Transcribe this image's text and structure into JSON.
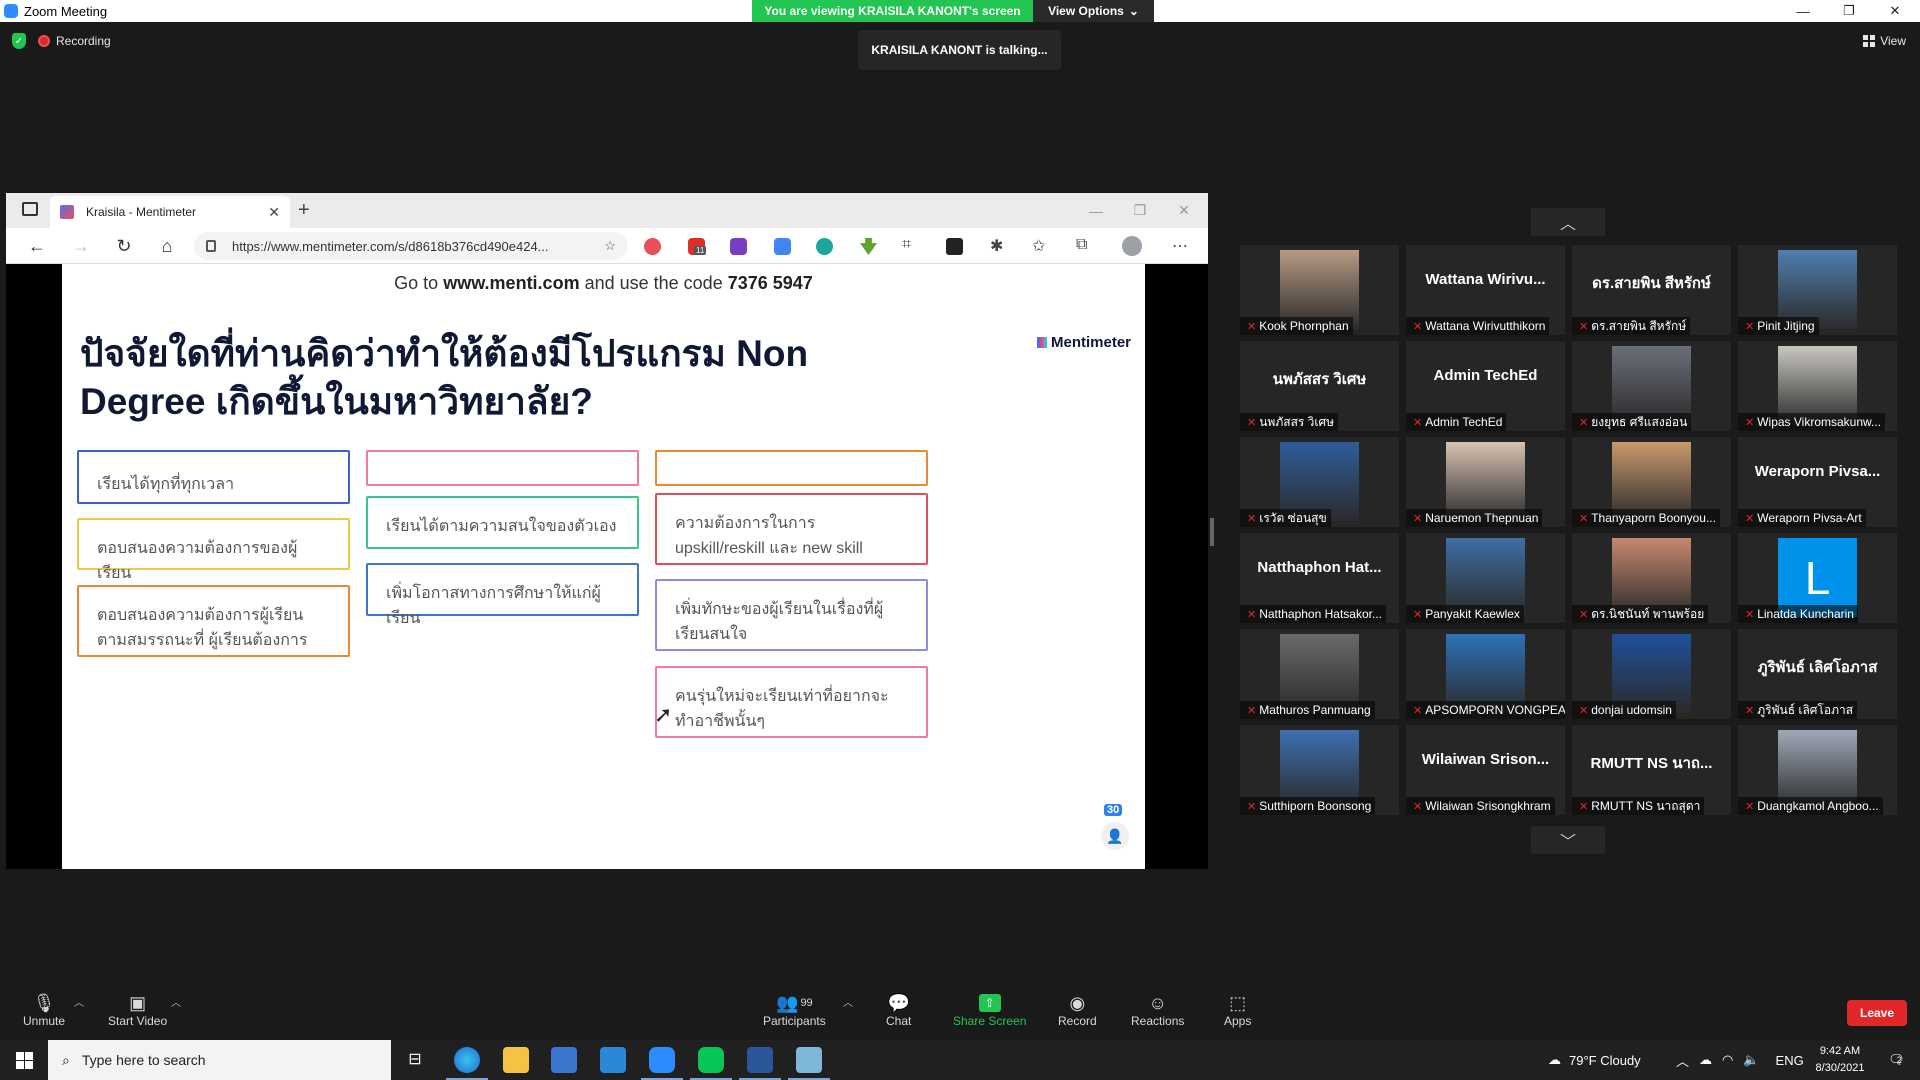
{
  "window": {
    "title": "Zoom Meeting",
    "viewing_banner": "You are viewing KRAISILA KANONT's screen",
    "view_options": "View Options"
  },
  "top": {
    "recording": "Recording",
    "talking": "KRAISILA KANONT is talking...",
    "view": "View"
  },
  "browser": {
    "tab_title": "Kraisila - Mentimeter",
    "url": "https://www.mentimeter.com/s/d8618b376cd490e424...",
    "ext_badge": "11"
  },
  "slide": {
    "code_prefix": "Go to",
    "code_site": "www.menti.com",
    "code_mid": "and use the code",
    "code_value": "7376 5947",
    "question": "ปัจจัยใดที่ท่านคิดว่าทำให้ต้องมีโปรแกรม Non Degree เกิดขึ้นในมหาวิทยาลัย?",
    "brand": "Mentimeter",
    "participants": "30",
    "cards": [
      {
        "text": "เรียนได้ทุกที่ทุกเวลา",
        "color": "#3a62c9"
      },
      {
        "text": "ตอบสนองความต้องการของผู้เรียน",
        "color": "#f2c84b"
      },
      {
        "text": "ตอบสนองความต้องการผู้เรียน ตามสมรรถนะที่ ผู้เรียนต้องการ",
        "color": "#e8893a"
      },
      {
        "text": "",
        "color": "#ef7aa0"
      },
      {
        "text": "เรียนได้ตามความสนใจของตัวเอง",
        "color": "#3ec48b"
      },
      {
        "text": "เพิ่มโอกาสทางการศึกษาให้แก่ผู้เรียน",
        "color": "#3b78c9"
      },
      {
        "text": "",
        "color": "#e8893a"
      },
      {
        "text": "ความต้องการในการ upskill/reskill และ new skill",
        "color": "#e0505b"
      },
      {
        "text": "เพิ่มทักษะของผู้เรียนในเรื่องที่ผู้เรียนสนใจ",
        "color": "#8d8ce0"
      },
      {
        "text": "คนรุ่นใหม่จะเรียนเท่าที่อยากจะทำอาชีพนั้นๆ",
        "color": "#ef7aa0"
      }
    ]
  },
  "gallery": {
    "tiles": [
      {
        "label": "Kook Phornphan",
        "kind": "photo",
        "bg": "#b79a84"
      },
      {
        "label": "Wattana Wirivutthikorn",
        "kind": "name",
        "name": "Wattana  Wirivu..."
      },
      {
        "label": "ดร.สายพิน  สีหรักษ์",
        "kind": "name",
        "name": "ดร.สายพิน สีหรักษ์"
      },
      {
        "label": "Pinit Jitjing",
        "kind": "photo",
        "bg": "#4f7fb0"
      },
      {
        "label": "นพภัสสร วิเศษ",
        "kind": "name",
        "name": "นพภัสสร วิเศษ"
      },
      {
        "label": "Admin TechEd",
        "kind": "name",
        "name": "Admin TechEd"
      },
      {
        "label": "ยงยุทธ ศรีแสงอ่อน",
        "kind": "photo",
        "bg": "#6b6f7a"
      },
      {
        "label": "Wipas Vikromsakunw...",
        "kind": "photo",
        "bg": "#c9c6c0"
      },
      {
        "label": "เรวัต ซ่อนสุข",
        "kind": "photo",
        "bg": "#2f5d9a"
      },
      {
        "label": "Naruemon Thepnuan",
        "kind": "photo",
        "bg": "#d8c2b2"
      },
      {
        "label": "Thanyaporn Boonyou...",
        "kind": "photo",
        "bg": "#c99a6a"
      },
      {
        "label": "Weraporn Pivsa-Art",
        "kind": "name",
        "name": "Weraporn  Pivsa..."
      },
      {
        "label": "Natthaphon Hatsakor...",
        "kind": "name",
        "name": "Natthaphon  Hat..."
      },
      {
        "label": "Panyakit Kaewlex",
        "kind": "photo",
        "bg": "#3f6ea5"
      },
      {
        "label": "ดร.นิชนันท์ พานพร้อย",
        "kind": "photo",
        "bg": "#c88870"
      },
      {
        "label": "Linatda Kuncharin",
        "kind": "letter",
        "name": "L"
      },
      {
        "label": "Mathuros Panmuang",
        "kind": "photo",
        "bg": "#6a6a6a"
      },
      {
        "label": "APSOMPORN VONGPEA...",
        "kind": "photo",
        "bg": "#2d72b8"
      },
      {
        "label": "donjai udomsin",
        "kind": "photo",
        "bg": "#1f4f9a"
      },
      {
        "label": "ภูริพันธ์ เลิศโอภาส",
        "kind": "name",
        "name": "ภูริพันธ์ เลิศโอภาส"
      },
      {
        "label": "Sutthiporn Boonsong",
        "kind": "photo",
        "bg": "#3c6fb0"
      },
      {
        "label": "Wilaiwan Srisongkhram",
        "kind": "name",
        "name": "Wilaiwan  Srison..."
      },
      {
        "label": "RMUTT NS นาถสุดา",
        "kind": "name",
        "name": "RMUTT NS นาถ..."
      },
      {
        "label": "Duangkamol Angboo...",
        "kind": "photo",
        "bg": "#9fa9b8"
      }
    ]
  },
  "toolbar": {
    "unmute": "Unmute",
    "start_video": "Start Video",
    "participants": "Participants",
    "participants_count": "99",
    "chat": "Chat",
    "share_screen": "Share Screen",
    "record": "Record",
    "reactions": "Reactions",
    "apps": "Apps",
    "leave": "Leave"
  },
  "taskbar": {
    "search_placeholder": "Type here to search",
    "weather": "79°F  Cloudy",
    "lang": "ENG",
    "time": "9:42 AM",
    "date": "8/30/2021",
    "notifications": "2"
  }
}
